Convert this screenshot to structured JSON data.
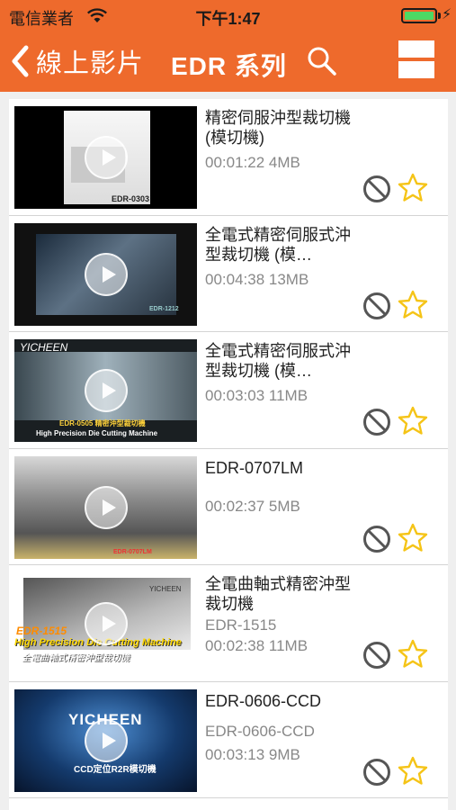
{
  "status_bar": {
    "carrier": "電信業者",
    "time": "下午1:47",
    "battery": 1.0
  },
  "nav": {
    "back_label": "線上影片",
    "title": "EDR 系列"
  },
  "videos": [
    {
      "title": "精密伺服沖型裁切機(模切機)",
      "model": "",
      "meta": "00:01:22 4MB",
      "thumb_caption": "EDR-0303"
    },
    {
      "title": "全電式精密伺服式沖型裁切機 (模…",
      "model": "",
      "meta": "00:04:38 13MB",
      "thumb_caption": "EDR-1212"
    },
    {
      "title": "全電式精密伺服式沖型裁切機 (模…",
      "model": "",
      "meta": "00:03:03 11MB",
      "thumb_logo": "YICHEEN",
      "thumb_caption": "EDR-0505 精密沖型裁切機",
      "thumb_caption2": "High Precision Die Cutting Machine"
    },
    {
      "title": "EDR-0707LM",
      "model": "",
      "meta": "00:02:37 5MB",
      "thumb_caption": "EDR-0707LM"
    },
    {
      "title": "全電曲軸式精密沖型裁切機",
      "model": "EDR-1515",
      "meta": "00:02:38 11MB",
      "thumb_logo": "YICHEEN",
      "thumb_caption": "EDR-1515",
      "thumb_caption2": "High Precision Die Cutting Machine",
      "thumb_caption3": "全電曲軸式精密沖型裁切機"
    },
    {
      "title": "EDR-0606-CCD",
      "model": "EDR-0606-CCD",
      "meta": "00:03:13 9MB",
      "thumb_logo": "YICHEEN",
      "thumb_caption": "CCD定位R2R模切機"
    }
  ],
  "colors": {
    "accent": "#ee6a2c",
    "star": "#f5c417",
    "block": "#555555"
  },
  "icons": {
    "back": "chevron-left-icon",
    "search": "search-icon",
    "menu": "menu-icon",
    "play": "play-icon",
    "block": "block-icon",
    "favorite": "star-icon"
  }
}
